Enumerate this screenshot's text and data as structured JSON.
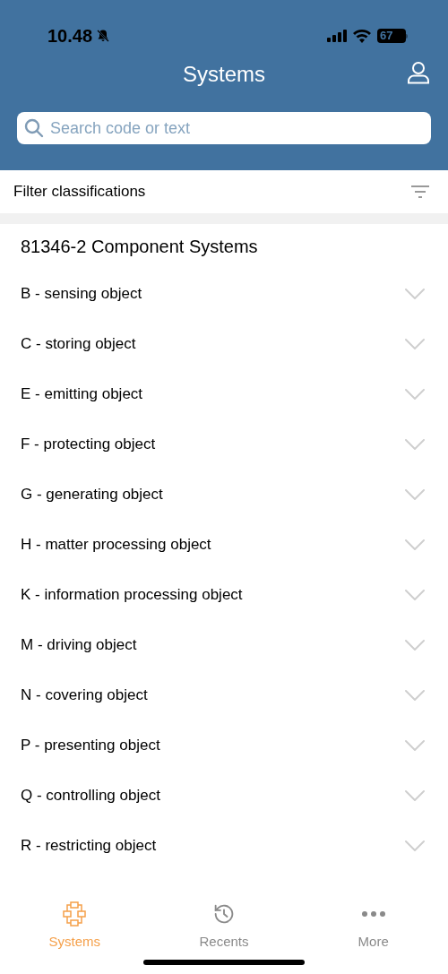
{
  "status_bar": {
    "time": "10.48",
    "battery": "67"
  },
  "header": {
    "title": "Systems"
  },
  "search": {
    "placeholder": "Search code or text"
  },
  "filter": {
    "label": "Filter classifications"
  },
  "section": {
    "title": "81346-2 Component Systems"
  },
  "items": [
    {
      "label": "B - sensing object",
      "expanded": false
    },
    {
      "label": "C - storing object",
      "expanded": false
    },
    {
      "label": "E - emitting object",
      "expanded": false
    },
    {
      "label": "F - protecting object",
      "expanded": false
    },
    {
      "label": "G - generating object",
      "expanded": false
    },
    {
      "label": "H - matter processing object",
      "expanded": false
    },
    {
      "label": "K - information processing object",
      "expanded": false
    },
    {
      "label": "M - driving object",
      "expanded": false
    },
    {
      "label": "N - covering object",
      "expanded": false
    },
    {
      "label": "P - presenting object",
      "expanded": false
    },
    {
      "label": "Q - controlling object",
      "expanded": false
    },
    {
      "label": "R - restricting object",
      "expanded": false
    }
  ],
  "tab_bar": [
    {
      "kind": "systems",
      "label": "Systems",
      "selected": true
    },
    {
      "kind": "recents",
      "label": "Recents",
      "selected": false
    },
    {
      "kind": "more",
      "label": "More",
      "selected": false
    }
  ]
}
